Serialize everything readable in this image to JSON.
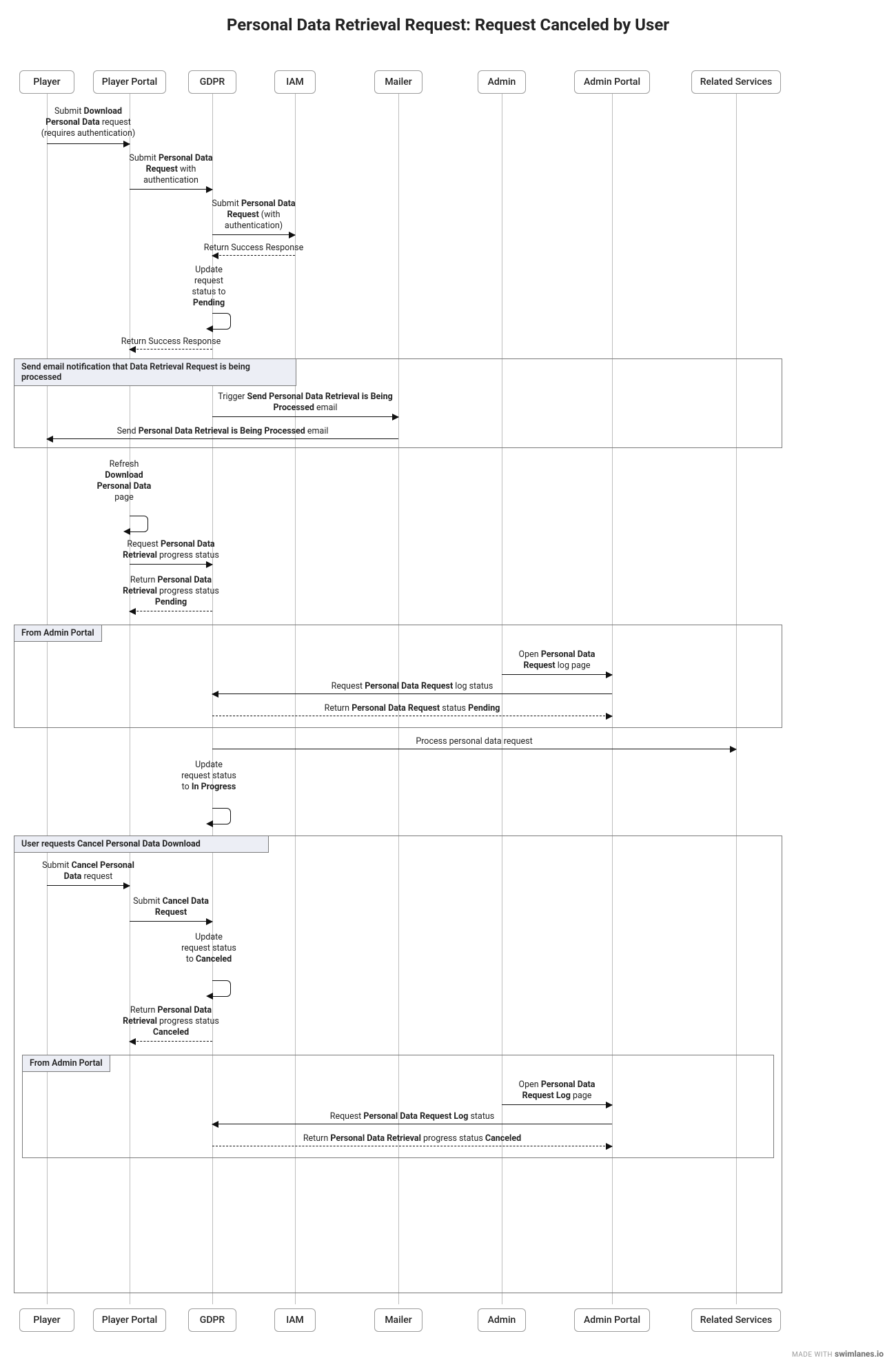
{
  "title": "Personal Data Retrieval Request: Request Canceled by User",
  "watermark_prefix": "made with ",
  "watermark_brand": "swimlanes.io",
  "actors": [
    {
      "id": "player",
      "label": "Player"
    },
    {
      "id": "portal",
      "label": "Player Portal"
    },
    {
      "id": "gdpr",
      "label": "GDPR"
    },
    {
      "id": "iam",
      "label": "IAM"
    },
    {
      "id": "mailer",
      "label": "Mailer"
    },
    {
      "id": "admin",
      "label": "Admin"
    },
    {
      "id": "adminportal",
      "label": "Admin Portal"
    },
    {
      "id": "related",
      "label": "Related Services"
    }
  ],
  "groups": {
    "email": {
      "title_html": "Send email notification that Data Retrieval Request is being processed"
    },
    "adminportal1": {
      "title_html": "From Admin Portal"
    },
    "cancel": {
      "title_html": "User requests <b>Cancel Personal Data Download</b>"
    },
    "adminportal2": {
      "title_html": "From Admin Portal"
    }
  },
  "messages": {
    "m1": "Submit <b>Download Personal Data</b> request (requires authentication)",
    "m2": "Submit <b>Personal Data Request</b> with authentication",
    "m3": "Submit <b>Personal Data Request</b> (with authentication)",
    "m4": "Return Success Response",
    "m5": "Update request status to <b>Pending</b>",
    "m6": "Return Success Response",
    "m7": "Trigger <b>Send Personal Data Retrieval is Being Processed</b> email",
    "m8": "Send <b>Personal Data Retrieval is Being Processed</b> email",
    "m9": "Refresh <b>Download Personal Data</b> page",
    "m10": "Request <b>Personal Data Retrieval</b> progress status",
    "m11": "Return <b>Personal Data Retrieval</b> progress status <b>Pending</b>",
    "m12": "Open <b>Personal Data Request</b> log page",
    "m13": "Request <b>Personal Data Request</b> log status",
    "m14": "Return <b>Personal Data Request</b> status <b>Pending</b>",
    "m15": "Process personal data request",
    "m16": "Update request status to <b>In Progress</b>",
    "m17": "Submit <b>Cancel Personal Data</b> request",
    "m18": "Submit <b>Cancel Data Request</b>",
    "m19": "Update request status to <b>Canceled</b>",
    "m20": "Return <b>Personal Data Retrieval</b> progress status <b>Canceled</b>",
    "m21": "Open <b>Personal Data Request Log</b> page",
    "m22": "Request <b>Personal Data Request Log</b> status",
    "m23": "Return <b>Personal Data Retrieval</b> progress status <b>Canceled</b>"
  }
}
